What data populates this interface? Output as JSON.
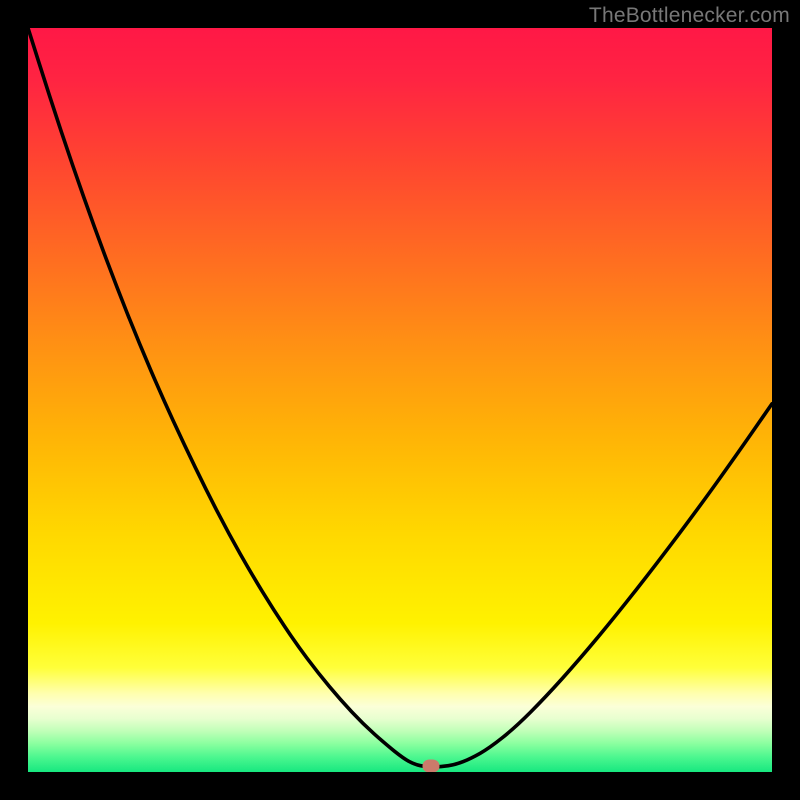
{
  "watermark": {
    "text": "TheBottlenecker.com"
  },
  "marker": {
    "color": "#cb7b6b",
    "x_frac": 0.541,
    "y_frac": 0.992
  },
  "gradient": {
    "stops": [
      {
        "offset": 0.0,
        "color": "#ff1846"
      },
      {
        "offset": 0.07,
        "color": "#ff2442"
      },
      {
        "offset": 0.18,
        "color": "#ff4530"
      },
      {
        "offset": 0.3,
        "color": "#ff6a22"
      },
      {
        "offset": 0.42,
        "color": "#ff8f14"
      },
      {
        "offset": 0.55,
        "color": "#ffb406"
      },
      {
        "offset": 0.68,
        "color": "#ffd800"
      },
      {
        "offset": 0.8,
        "color": "#fff200"
      },
      {
        "offset": 0.86,
        "color": "#ffff3a"
      },
      {
        "offset": 0.895,
        "color": "#ffffb0"
      },
      {
        "offset": 0.912,
        "color": "#fbffd8"
      },
      {
        "offset": 0.928,
        "color": "#e8ffd0"
      },
      {
        "offset": 0.945,
        "color": "#c0ffb8"
      },
      {
        "offset": 0.962,
        "color": "#8aff9f"
      },
      {
        "offset": 0.98,
        "color": "#4cf78f"
      },
      {
        "offset": 1.0,
        "color": "#17e880"
      }
    ]
  },
  "chart_data": {
    "type": "line",
    "title": "",
    "xlabel": "",
    "ylabel": "",
    "xlim": [
      0,
      1
    ],
    "ylim": [
      0,
      1
    ],
    "series": [
      {
        "name": "bottleneck-curve",
        "x": [
          0.0,
          0.03,
          0.06,
          0.09,
          0.12,
          0.15,
          0.18,
          0.21,
          0.24,
          0.27,
          0.3,
          0.33,
          0.36,
          0.39,
          0.42,
          0.45,
          0.48,
          0.505,
          0.52,
          0.535,
          0.555,
          0.575,
          0.595,
          0.62,
          0.655,
          0.695,
          0.74,
          0.79,
          0.845,
          0.905,
          0.955,
          1.0
        ],
        "y": [
          0.0,
          0.095,
          0.185,
          0.27,
          0.35,
          0.425,
          0.495,
          0.56,
          0.622,
          0.68,
          0.733,
          0.782,
          0.827,
          0.867,
          0.903,
          0.935,
          0.962,
          0.982,
          0.99,
          0.993,
          0.993,
          0.99,
          0.982,
          0.968,
          0.94,
          0.9,
          0.85,
          0.79,
          0.72,
          0.64,
          0.57,
          0.505
        ]
      }
    ],
    "marker_point": {
      "x": 0.541,
      "y": 0.008
    },
    "notes": "x and y are fractions of the plot area (0..1). y measured from top; the chart visual renders y=1 at bottom edge."
  }
}
